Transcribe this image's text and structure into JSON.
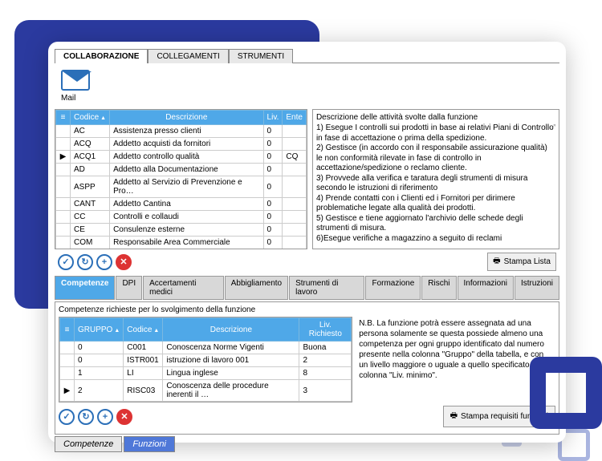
{
  "tabs_top": {
    "collab": "COLLABORAZIONE",
    "colleg": "COLLEGAMENTI",
    "strum": "STRUMENTI"
  },
  "mail_label": "Mail",
  "main_table": {
    "headers": {
      "codice": "Codice",
      "descr": "Descrizione",
      "liv": "Liv.",
      "ente": "Ente"
    },
    "rows": [
      {
        "cod": "AC",
        "desc": "Assistenza presso clienti",
        "liv": "0",
        "ente": ""
      },
      {
        "cod": "ACQ",
        "desc": "Addetto acquisti da fornitori",
        "liv": "0",
        "ente": ""
      },
      {
        "cod": "ACQ1",
        "desc": "Addetto controllo qualità",
        "liv": "0",
        "ente": "CQ",
        "sel": true
      },
      {
        "cod": "AD",
        "desc": "Addetto alla Documentazione",
        "liv": "0",
        "ente": ""
      },
      {
        "cod": "ASPP",
        "desc": "Addetto al Servizio di Prevenzione e Pro…",
        "liv": "0",
        "ente": ""
      },
      {
        "cod": "CANT",
        "desc": "Addetto Cantina",
        "liv": "0",
        "ente": ""
      },
      {
        "cod": "CC",
        "desc": "Controlli e collaudi",
        "liv": "0",
        "ente": ""
      },
      {
        "cod": "CE",
        "desc": "Consulenze esterne",
        "liv": "0",
        "ente": ""
      },
      {
        "cod": "COM",
        "desc": "Responsabile Area Commerciale",
        "liv": "0",
        "ente": ""
      }
    ]
  },
  "desc_title": "Descrizione delle attività svolte dalla funzione",
  "desc_text": "1) Esegue I controlli sui prodotti in base ai relativi Piani di Controllo in fase di accettazione o prima della spedizione.\n2) Gestisce (in accordo con il responsabile assicurazione qualità) le non conformità rilevate in fase di controllo in accettazione/spedizione o reclamo cliente.\n3) Provvede alla verifica e taratura degli strumenti di misura secondo le istruzioni di riferimento\n4) Prende contatti con i Clienti ed i Fornitori per dirimere problematiche legate alla qualità dei prodotti.\n5) Gestisce e tiene aggiornato l'archivio delle schede degli strumenti di misura.\n6)Esegue verifiche a magazzino a seguito di reclami",
  "print_list": "Stampa Lista",
  "sub_tabs": [
    "Competenze",
    "DPI",
    "Accertamenti medici",
    "Abbigliamento",
    "Strumenti di lavoro",
    "Formazione",
    "Rischi",
    "Informazioni",
    "Istruzioni"
  ],
  "comp_title": "Competenze richieste per lo svolgimento della funzione",
  "comp_table": {
    "headers": {
      "gruppo": "GRUPPO",
      "codice": "Codice",
      "descr": "Descrizione",
      "liv": "Liv. Richiesto"
    },
    "rows": [
      {
        "g": "0",
        "c": "C001",
        "d": "Conoscenza Norme Vigenti",
        "l": "Buona"
      },
      {
        "g": "0",
        "c": "ISTR001",
        "d": "istruzione di lavoro 001",
        "l": "2"
      },
      {
        "g": "1",
        "c": "LI",
        "d": "Lingua inglese",
        "l": "8"
      },
      {
        "g": "2",
        "c": "RISC03",
        "d": "Conoscenza delle procedure inerenti il …",
        "l": "3",
        "sel": true
      }
    ]
  },
  "comp_note": "N.B. La funzione potrà essere assegnata ad una persona solamente se questa possiede almeno una competenza per ogni gruppo identificato dal numero presente nella colonna \"Gruppo\" della tabella, e con un livello maggiore o uguale a quello specificato nella colonna \"Liv. minimo\".",
  "print_req": "Stampa requisiti funzioni",
  "bottom_tabs": {
    "comp": "Competenze",
    "funz": "Funzioni"
  }
}
